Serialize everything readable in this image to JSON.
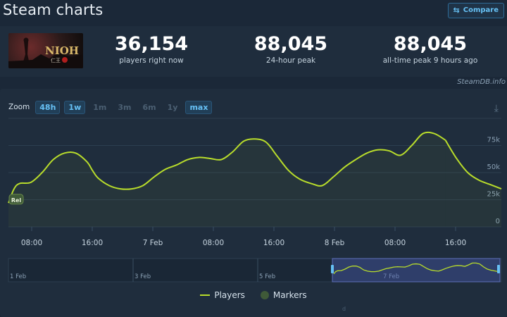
{
  "header": {
    "title": "Steam charts",
    "compare_label": "Compare",
    "compare_icon": "compare-icon"
  },
  "stats": [
    {
      "value": "36,154",
      "label": "players right now"
    },
    {
      "value": "88,045",
      "label": "24-hour peak"
    },
    {
      "value": "88,045",
      "label": "all-time peak 9 hours ago"
    }
  ],
  "game_logo_text": "NIOH",
  "credit": "SteamDB.info",
  "zoom": {
    "label": "Zoom",
    "options": [
      {
        "label": "48h",
        "active": true
      },
      {
        "label": "1w",
        "active": true
      },
      {
        "label": "1m",
        "active": false
      },
      {
        "label": "3m",
        "active": false
      },
      {
        "label": "6m",
        "active": false
      },
      {
        "label": "1y",
        "active": false
      },
      {
        "label": "max",
        "active": true
      }
    ]
  },
  "legend": {
    "players": "Players",
    "markers": "Markers"
  },
  "colors": {
    "line": "#b8dc2b",
    "accent": "#66c0f4",
    "background": "#1b2838",
    "panel": "#1f2d3d"
  },
  "chart_data": {
    "type": "line",
    "x_ticks": [
      "08:00",
      "16:00",
      "7 Feb",
      "08:00",
      "16:00",
      "8 Feb",
      "08:00",
      "16:00"
    ],
    "y_ticks": [
      "0",
      "25k",
      "50k",
      "75k"
    ],
    "ylim": [
      0,
      100000
    ],
    "grid": true,
    "legend_position": "bottom",
    "marker": {
      "label": "Rel",
      "x_hours": 0
    },
    "series": [
      {
        "name": "Players",
        "x_hours": [
          0,
          1,
          2,
          4,
          6,
          8,
          10,
          12,
          14,
          15,
          16,
          18,
          20,
          22,
          24,
          26,
          28,
          30,
          32,
          34,
          36,
          38,
          40,
          42,
          44,
          46,
          48,
          50,
          52,
          54,
          56,
          58,
          60,
          62,
          64,
          66,
          68,
          70,
          72,
          74,
          76,
          78
        ],
        "values": [
          22000,
          35000,
          40000,
          41000,
          50000,
          62000,
          68000,
          68000,
          60000,
          52000,
          45000,
          38000,
          35000,
          35000,
          38000,
          46000,
          53000,
          57000,
          62000,
          64000,
          63000,
          62000,
          69000,
          79000,
          81000,
          78000,
          65000,
          52000,
          44000,
          40000,
          38000,
          46000,
          55000,
          62000,
          68000,
          71000,
          70000,
          66000,
          75000,
          86000,
          86000,
          80000
        ]
      },
      {
        "name": "Players",
        "x_hours": [
          78,
          80,
          82,
          84,
          86,
          88
        ],
        "values": [
          80000,
          63000,
          50000,
          43000,
          39000,
          35000
        ]
      }
    ],
    "navigator": {
      "labels": [
        "1 Feb",
        "3 Feb",
        "5 Feb",
        "7 Feb"
      ],
      "selected_range": "6 Feb - 8 Feb"
    }
  }
}
